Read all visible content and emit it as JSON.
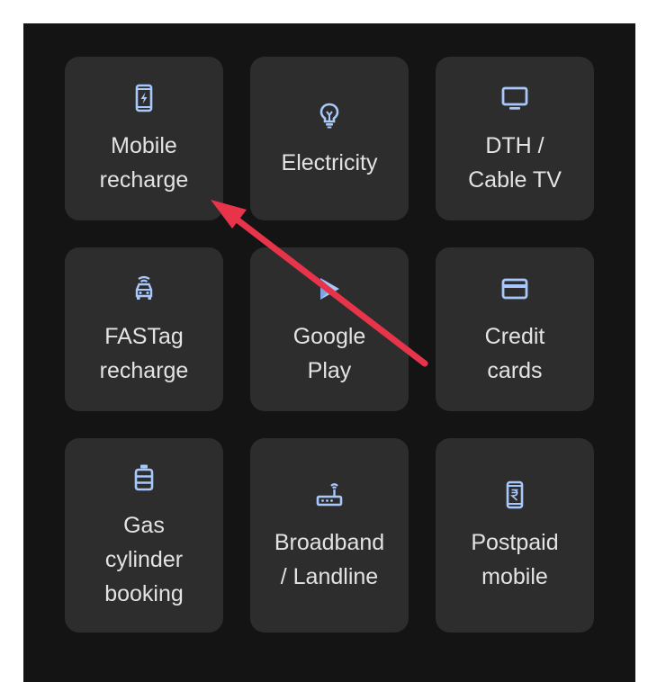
{
  "tiles": [
    {
      "label": "Mobile\nrecharge",
      "icon": "mobile-recharge-icon"
    },
    {
      "label": "Electricity",
      "icon": "lightbulb-icon"
    },
    {
      "label": "DTH /\nCable TV",
      "icon": "tv-icon"
    },
    {
      "label": "FASTag\nrecharge",
      "icon": "car-icon"
    },
    {
      "label": "Google\nPlay",
      "icon": "google-play-icon"
    },
    {
      "label": "Credit\ncards",
      "icon": "credit-card-icon"
    },
    {
      "label": "Gas\ncylinder\nbooking",
      "icon": "gas-cylinder-icon"
    },
    {
      "label": "Broadband\n/ Landline",
      "icon": "router-icon"
    },
    {
      "label": "Postpaid\nmobile",
      "icon": "postpaid-mobile-icon"
    }
  ],
  "colors": {
    "panel_bg": "#141414",
    "tile_bg": "#2d2d2d",
    "icon": "#a8c7fa",
    "text": "#e3e3e3",
    "arrow": "#e8344a"
  }
}
